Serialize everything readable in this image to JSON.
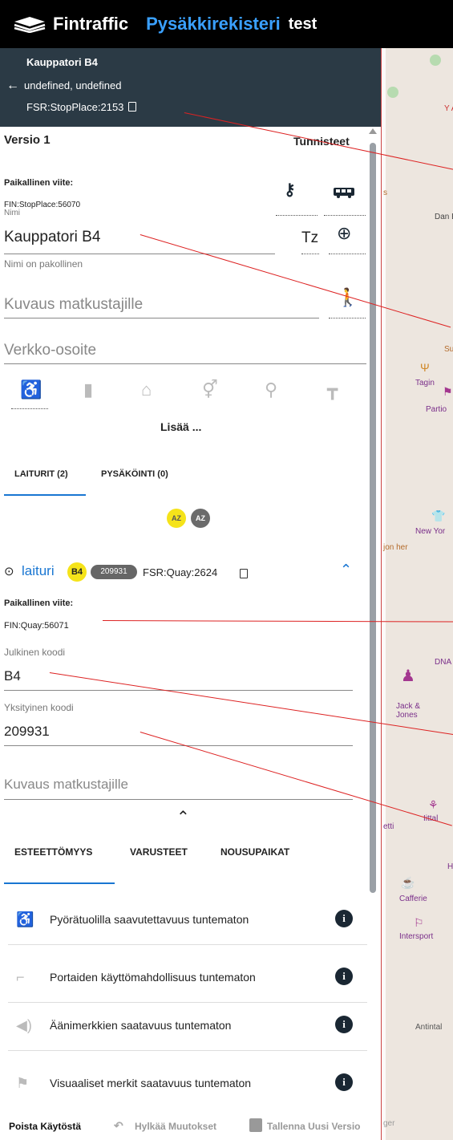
{
  "topbar": {
    "brand": "Fintraffic",
    "app": "Pysäkkirekisteri",
    "env": "test"
  },
  "header": {
    "name": "Kauppatori B4",
    "location": "undefined, undefined",
    "id": "FSR:StopPlace:2153"
  },
  "version": {
    "label": "Versio 1",
    "identifiers": "Tunnisteet"
  },
  "local_ref": {
    "label": "Paikallinen viite:",
    "value": "FIN:StopPlace:56070"
  },
  "name_field": {
    "label": "Nimi",
    "value": "Kauppatori B4",
    "tz": "Tz",
    "helper": "Nimi on pakollinen"
  },
  "description": {
    "placeholder": "Kuvaus matkustajille"
  },
  "website": {
    "placeholder": "Verkko-osoite"
  },
  "more": "Lisää ...",
  "tabs": [
    {
      "label": "LAITURIT (2)"
    },
    {
      "label": "PYSÄKÖINTI (0)"
    }
  ],
  "sort": {
    "az": "AZ"
  },
  "quay": {
    "title": "laituri",
    "code_badge": "B4",
    "private_badge": "209931",
    "id": "FSR:Quay:2624",
    "local_ref_label": "Paikallinen viite:",
    "local_ref_value": "FIN:Quay:56071",
    "public_code_label": "Julkinen koodi",
    "public_code": "B4",
    "private_code_label": "Yksityinen koodi",
    "private_code": "209931",
    "desc_placeholder": "Kuvaus matkustajille"
  },
  "sub_tabs": [
    {
      "label": "ESTEETTÖMYYS"
    },
    {
      "label": "VARUSTEET"
    },
    {
      "label": "NOUSUPAIKAT"
    }
  ],
  "accessibility": [
    {
      "text": "Pyörätuolilla saavutettavuus tuntematon",
      "icon": "wheelchair-icon"
    },
    {
      "text": "Portaiden käyttömahdollisuus tuntematon",
      "icon": "stairs-icon"
    },
    {
      "text": "Äänimerkkien saatavuus tuntematon",
      "icon": "speaker-icon"
    },
    {
      "text": "Visuaaliset merkit saatavuus tuntematon",
      "icon": "sign-icon"
    }
  ],
  "footer": {
    "deactivate": "Poista Käytöstä",
    "discard": "Hylkää Muutokset",
    "save": "Tallenna Uusi Versio"
  },
  "map_labels": {
    "tagin": "Tagin",
    "partio": "Partio",
    "new_york": "New Yor",
    "jack": "Jack & Jones",
    "iittala": "Iittal",
    "dna": "DNA",
    "cafferie": "Cafferie",
    "intersport": "Intersport",
    "antintal": "Antintal",
    "su": "Su",
    "dan": "Dan Ba",
    "on": "jon her",
    "etti": "etti",
    "ger": "ger",
    "ya": "Y A",
    "s": "s",
    "h": "H"
  },
  "colors": {
    "accent": "#1976d2",
    "header_bg": "#2b3a45",
    "badge_yellow": "#f5e31a",
    "info_dark": "#1a2733"
  }
}
